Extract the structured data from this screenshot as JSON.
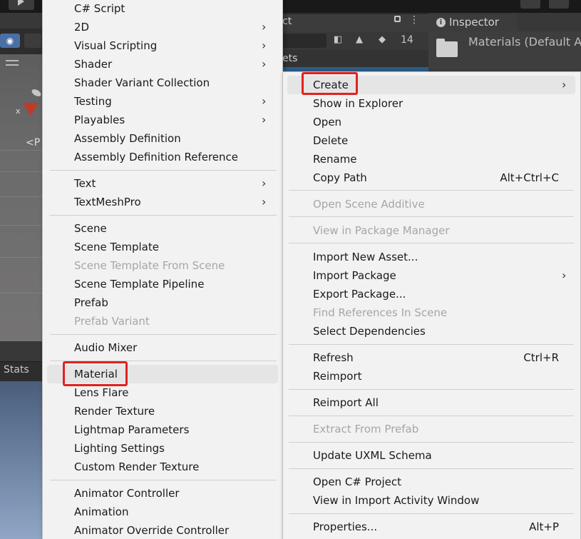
{
  "editor": {
    "stats_tab": "Stats",
    "persp_label": "<P",
    "axis_x": "x",
    "project_tab_partial": "ct",
    "assets_partial": "ets",
    "eye_count": "14",
    "inspector": {
      "tab_label": "Inspector",
      "title": "Materials (Default As"
    }
  },
  "create_submenu": {
    "items": [
      {
        "label": "C# Script",
        "arrow": false,
        "disabled": false
      },
      {
        "label": "2D",
        "arrow": true,
        "disabled": false
      },
      {
        "label": "Visual Scripting",
        "arrow": true,
        "disabled": false
      },
      {
        "label": "Shader",
        "arrow": true,
        "disabled": false
      },
      {
        "label": "Shader Variant Collection",
        "arrow": false,
        "disabled": false
      },
      {
        "label": "Testing",
        "arrow": true,
        "disabled": false
      },
      {
        "label": "Playables",
        "arrow": true,
        "disabled": false
      },
      {
        "label": "Assembly Definition",
        "arrow": false,
        "disabled": false
      },
      {
        "label": "Assembly Definition Reference",
        "arrow": false,
        "disabled": false
      },
      {
        "label": "Text",
        "arrow": true,
        "disabled": false
      },
      {
        "label": "TextMeshPro",
        "arrow": true,
        "disabled": false
      },
      {
        "label": "Scene",
        "arrow": false,
        "disabled": false
      },
      {
        "label": "Scene Template",
        "arrow": false,
        "disabled": false
      },
      {
        "label": "Scene Template From Scene",
        "arrow": false,
        "disabled": true
      },
      {
        "label": "Scene Template Pipeline",
        "arrow": false,
        "disabled": false
      },
      {
        "label": "Prefab",
        "arrow": false,
        "disabled": false
      },
      {
        "label": "Prefab Variant",
        "arrow": false,
        "disabled": true
      },
      {
        "label": "Audio Mixer",
        "arrow": false,
        "disabled": false
      },
      {
        "label": "Material",
        "arrow": false,
        "disabled": false,
        "highlighted": true
      },
      {
        "label": "Lens Flare",
        "arrow": false,
        "disabled": false
      },
      {
        "label": "Render Texture",
        "arrow": false,
        "disabled": false
      },
      {
        "label": "Lightmap Parameters",
        "arrow": false,
        "disabled": false
      },
      {
        "label": "Lighting Settings",
        "arrow": false,
        "disabled": false
      },
      {
        "label": "Custom Render Texture",
        "arrow": false,
        "disabled": false
      },
      {
        "label": "Animator Controller",
        "arrow": false,
        "disabled": false
      },
      {
        "label": "Animation",
        "arrow": false,
        "disabled": false
      },
      {
        "label": "Animator Override Controller",
        "arrow": false,
        "disabled": false
      }
    ]
  },
  "context_menu": {
    "items": [
      {
        "label": "Create",
        "arrow": true,
        "disabled": false,
        "highlighted": true
      },
      {
        "label": "Show in Explorer",
        "disabled": false
      },
      {
        "label": "Open",
        "disabled": false
      },
      {
        "label": "Delete",
        "disabled": false
      },
      {
        "label": "Rename",
        "disabled": false
      },
      {
        "label": "Copy Path",
        "shortcut": "Alt+Ctrl+C",
        "disabled": false
      },
      {
        "label": "Open Scene Additive",
        "disabled": true
      },
      {
        "label": "View in Package Manager",
        "disabled": true
      },
      {
        "label": "Import New Asset...",
        "disabled": false
      },
      {
        "label": "Import Package",
        "arrow": true,
        "disabled": false
      },
      {
        "label": "Export Package...",
        "disabled": false
      },
      {
        "label": "Find References In Scene",
        "disabled": true
      },
      {
        "label": "Select Dependencies",
        "disabled": false
      },
      {
        "label": "Refresh",
        "shortcut": "Ctrl+R",
        "disabled": false
      },
      {
        "label": "Reimport",
        "disabled": false
      },
      {
        "label": "Reimport All",
        "disabled": false
      },
      {
        "label": "Extract From Prefab",
        "disabled": true
      },
      {
        "label": "Update UXML Schema",
        "disabled": false
      },
      {
        "label": "Open C# Project",
        "disabled": false
      },
      {
        "label": "View in Import Activity Window",
        "disabled": false
      },
      {
        "label": "Properties...",
        "shortcut": "Alt+P",
        "disabled": false
      }
    ]
  },
  "colors": {
    "menu_bg": "#f2f2f2",
    "highlight_box": "#e32020",
    "disabled_text": "#a6a6a6",
    "editor_dark": "#383838",
    "selection_blue": "#2c5d87"
  }
}
